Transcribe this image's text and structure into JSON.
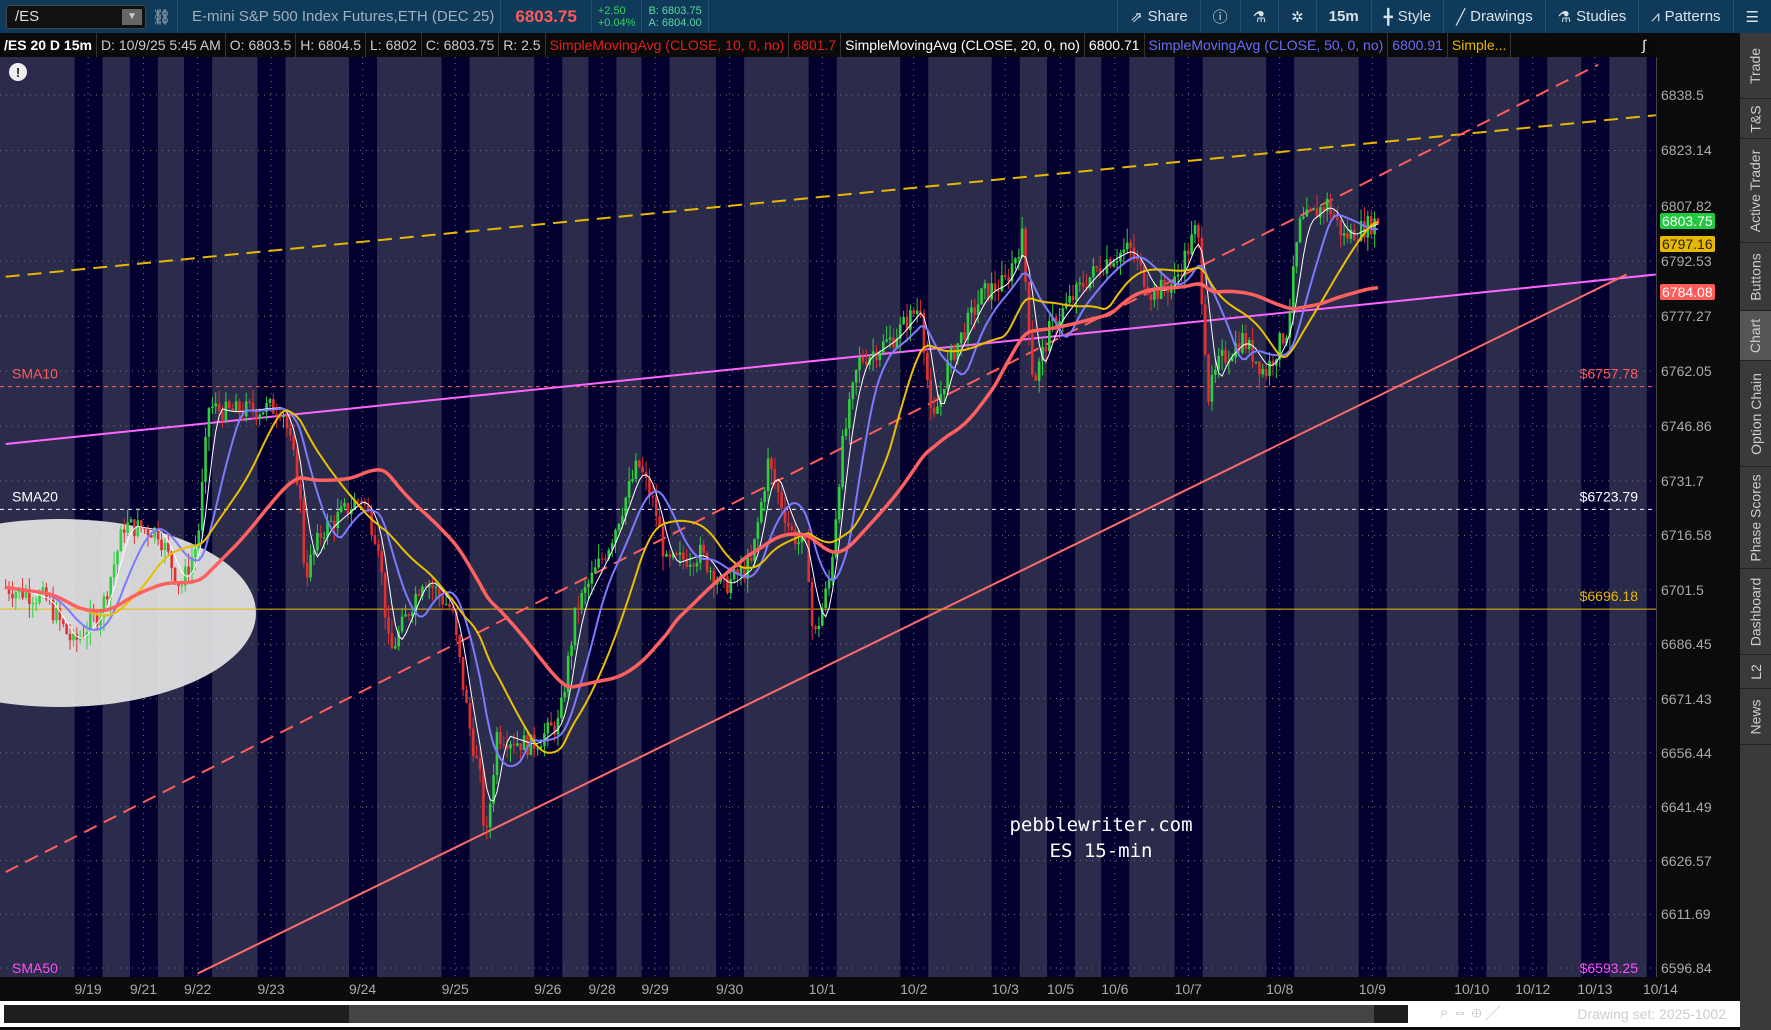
{
  "toolbar": {
    "symbol": "/ES",
    "description": "E-mini S&P 500 Index Futures,ETH (DEC 25)",
    "last": "6803.75",
    "change": "+2.50",
    "change_pct": "+0.04%",
    "bid": "B: 6803.75",
    "ask": "A: 6804.00",
    "share": "Share",
    "timeframe": "15m",
    "style": "Style",
    "drawings": "Drawings",
    "studies": "Studies",
    "patterns": "Patterns"
  },
  "infobar": {
    "title": "/ES 20 D 15m",
    "date": "D: 10/9/25 5:45 AM",
    "open": "O: 6803.5",
    "high": "H: 6804.5",
    "low": "L: 6802",
    "close": "C: 6803.75",
    "range": "R: 2.5",
    "sma10": "SimpleMovingAvg (CLOSE, 10, 0, no)",
    "sma10_val": "6801.7",
    "sma20": "SimpleMovingAvg (CLOSE, 20, 0, no)",
    "sma20_val": "6800.71",
    "sma50": "SimpleMovingAvg (CLOSE, 50, 0, no)",
    "sma50_val": "6800.91",
    "more": "Simple..."
  },
  "price_axis": [
    "6838.5",
    "6823.14",
    "6807.82",
    "6792.53",
    "6777.27",
    "6762.05",
    "6746.86",
    "6731.7",
    "6716.58",
    "6701.5",
    "6686.45",
    "6671.43",
    "6656.44",
    "6641.49",
    "6626.57",
    "6611.69",
    "6596.84"
  ],
  "price_tags": [
    {
      "value": "6803.75",
      "color": "#22c840"
    },
    {
      "value": "6797.16",
      "color": "#e8b800"
    },
    {
      "value": "6784.08",
      "color": "#ff5c5c"
    }
  ],
  "levels": [
    {
      "label": "SMA10",
      "value": 6757.78,
      "text": "$6757.78",
      "color": "#ff5c5c",
      "dash": true
    },
    {
      "label": "SMA20",
      "value": 6723.79,
      "text": "$6723.79",
      "color": "#ffffff",
      "dash": true
    },
    {
      "label": "",
      "value": 6696.18,
      "text": "$6696.18",
      "color": "#e8b800",
      "dash": false
    },
    {
      "label": "SMA50",
      "value": 6593.25,
      "text": "$6593.25",
      "color": "#ff4cff",
      "dash": false
    }
  ],
  "dates": [
    {
      "l": "9/19",
      "b": 78
    },
    {
      "l": "9/21",
      "b": 127
    },
    {
      "l": "9/22",
      "b": 175
    },
    {
      "l": "9/23",
      "b": 240
    },
    {
      "l": "9/24",
      "b": 321
    },
    {
      "l": "9/25",
      "b": 403
    },
    {
      "l": "9/26",
      "b": 485
    },
    {
      "l": "9/28",
      "b": 533
    },
    {
      "l": "9/29",
      "b": 580
    },
    {
      "l": "9/30",
      "b": 646
    },
    {
      "l": "10/1",
      "b": 728
    },
    {
      "l": "10/2",
      "b": 809
    },
    {
      "l": "10/3",
      "b": 890
    },
    {
      "l": "10/5",
      "b": 939
    },
    {
      "l": "10/6",
      "b": 987
    },
    {
      "l": "10/7",
      "b": 1052
    },
    {
      "l": "10/8",
      "b": 1133
    },
    {
      "l": "10/9",
      "b": 1215
    },
    {
      "l": "10/10",
      "b": 1303
    },
    {
      "l": "10/12",
      "b": 1357
    },
    {
      "l": "10/13",
      "b": 1412
    },
    {
      "l": "10/14",
      "b": 1470
    }
  ],
  "watermark": {
    "line1": "pebblewriter.com",
    "line2": "ES 15-min"
  },
  "sidebar": [
    "Trade",
    "T&S",
    "Active Trader",
    "Buttons",
    "Chart",
    "Option Chain",
    "Phase Scores",
    "Dashboard",
    "L2",
    "News"
  ],
  "drawing_set": "Drawing set: 2025-1002",
  "chart_data": {
    "type": "line",
    "x_unit": "bar index",
    "ylim": [
      6596.84,
      6846
    ],
    "price": [
      [
        5,
        6702.2
      ],
      [
        40,
        6699.1
      ],
      [
        65,
        6686.6
      ],
      [
        90,
        6696.0
      ],
      [
        110,
        6719.4
      ],
      [
        140,
        6717.8
      ],
      [
        160,
        6702.2
      ],
      [
        175,
        6714.7
      ],
      [
        185,
        6752.2
      ],
      [
        200,
        6750.7
      ],
      [
        250,
        6752.2
      ],
      [
        265,
        6730.3
      ],
      [
        270,
        6705.3
      ],
      [
        285,
        6717.8
      ],
      [
        320,
        6727.2
      ],
      [
        335,
        6714.7
      ],
      [
        345,
        6683.4
      ],
      [
        375,
        6705.3
      ],
      [
        400,
        6696.0
      ],
      [
        415,
        6664.7
      ],
      [
        425,
        6649.1
      ],
      [
        430,
        6630.3
      ],
      [
        440,
        6661.6
      ],
      [
        470,
        6658.4
      ],
      [
        495,
        6664.7
      ],
      [
        510,
        6696.0
      ],
      [
        540,
        6714.7
      ],
      [
        565,
        6736.6
      ],
      [
        580,
        6724.1
      ],
      [
        590,
        6708.5
      ],
      [
        620,
        6711.6
      ],
      [
        640,
        6702.2
      ],
      [
        665,
        6708.5
      ],
      [
        680,
        6736.6
      ],
      [
        700,
        6717.8
      ],
      [
        715,
        6711.6
      ],
      [
        720,
        6686.6
      ],
      [
        735,
        6705.3
      ],
      [
        745,
        6739.7
      ],
      [
        760,
        6764.7
      ],
      [
        790,
        6771.0
      ],
      [
        815,
        6780.4
      ],
      [
        825,
        6745.9
      ],
      [
        840,
        6764.7
      ],
      [
        870,
        6783.5
      ],
      [
        890,
        6786.6
      ],
      [
        905,
        6799.1
      ],
      [
        915,
        6758.5
      ],
      [
        930,
        6774.1
      ],
      [
        960,
        6786.6
      ],
      [
        980,
        6792.9
      ],
      [
        1000,
        6796.0
      ],
      [
        1020,
        6783.5
      ],
      [
        1040,
        6786.6
      ],
      [
        1060,
        6802.2
      ],
      [
        1070,
        6755.3
      ],
      [
        1080,
        6764.7
      ],
      [
        1100,
        6771.0
      ],
      [
        1120,
        6761.6
      ],
      [
        1140,
        6774.1
      ],
      [
        1150,
        6802.2
      ],
      [
        1175,
        6808.5
      ],
      [
        1190,
        6799.1
      ],
      [
        1220,
        6803.8
      ]
    ],
    "trendlines": [
      {
        "name": "upper-channel",
        "color": "#e8b800",
        "dash": true,
        "from": [
          5,
          6788.2
        ],
        "to": [
          1466,
          6832.9
        ]
      },
      {
        "name": "magenta-trend",
        "color": "#ff66ff",
        "dash": false,
        "from": [
          5,
          6741.9
        ],
        "to": [
          1466,
          6788.8
        ]
      },
      {
        "name": "red-channel",
        "color": "#ff5c5c",
        "dash": true,
        "from": [
          5,
          6623.4
        ],
        "to": [
          1415,
          6846.9
        ]
      },
      {
        "name": "lower-trend",
        "color": "#ff6b6b",
        "dash": false,
        "from": [
          175,
          6595.3
        ],
        "to": [
          1440,
          6788.8
        ]
      }
    ],
    "series_colors": {
      "sma10": "#ffffff",
      "sma20": "#7b7bff",
      "sma50": "#e8c000",
      "slow": "#ff6060"
    }
  }
}
